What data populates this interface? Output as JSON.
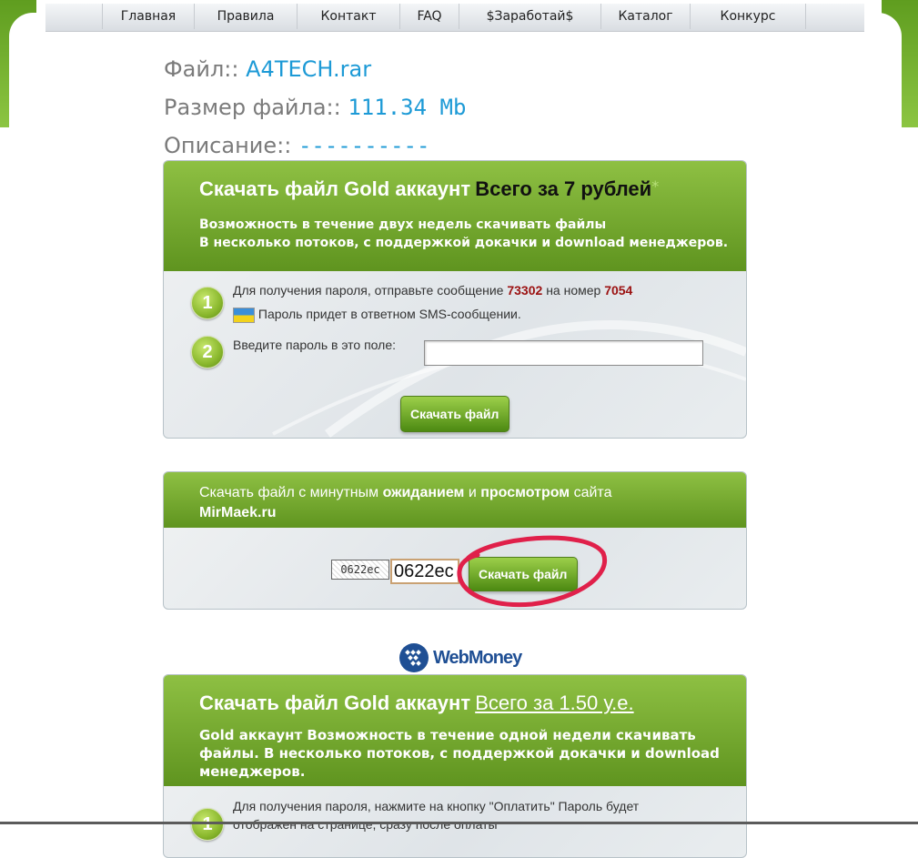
{
  "nav": {
    "items": [
      {
        "label": "Главная"
      },
      {
        "label": "Правила"
      },
      {
        "label": "Контакт"
      },
      {
        "label": "FAQ"
      },
      {
        "label": "$Заработай$"
      },
      {
        "label": "Каталог"
      },
      {
        "label": "Конкурс"
      },
      {
        "label": ""
      }
    ]
  },
  "file": {
    "name_label": "Файл::",
    "name_value": "A4TECH.rar",
    "size_label": "Размер файла::",
    "size_value": "111.34 Mb",
    "desc_label": "Описание::",
    "desc_value": "----------"
  },
  "sms_panel": {
    "title": "Скачать файл Gold аккаунт",
    "price": "Всего за 7 рублей",
    "star": "*",
    "sub_line1": "Возможность в течение двух недель скачивать файлы",
    "sub_line2": "В несколько потоков, с поддержкой докачки и download менеджеров.",
    "step1_num": "1",
    "step1_text_a": "Для получения пароля, отправьте сообщение",
    "step1_code": "73302",
    "step1_text_b": "на номер",
    "step1_number": "7054",
    "step1_note": "Пароль придет в ответном SMS-сообщении.",
    "step2_num": "2",
    "step2_text": "Введите пароль в это поле:",
    "button": "Скачать файл"
  },
  "free_panel": {
    "title_a": "Скачать файл  с минутным",
    "title_b": "ожиданием",
    "title_c": "и",
    "title_d": "просмотром",
    "title_e": "сайта",
    "title_site": "MirMaek.ru",
    "captcha_image_text": "0622ec",
    "captcha_value": "0622ec",
    "button": "Скачать файл"
  },
  "webmoney": {
    "label": "WebMoney"
  },
  "wm_panel": {
    "title": "Скачать файл Gold аккаунт",
    "price": "Всего за 1.50 у.е.",
    "sub": "Gold аккаунт Возможность в течение одной недели скачивать файлы. В несколько потоков, с поддержкой докачки и download менеджеров.",
    "step1_num": "1",
    "step1_text": "Для получения пароля, нажмите на кнопку \"Оплатить\" Пароль будет отображен на странице, сразу после оплаты"
  },
  "colors": {
    "accent_green": "#6fa82a",
    "link_blue": "#1d9ad6",
    "code_red": "#9b1111",
    "annotation": "#e0204a"
  },
  "icons": [
    "webmoney-logo-icon",
    "ukraine-flag-icon"
  ]
}
